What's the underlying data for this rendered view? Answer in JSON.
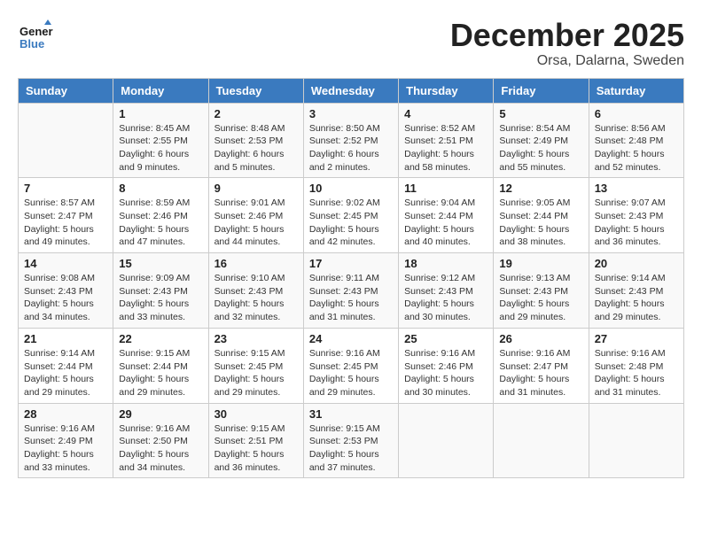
{
  "header": {
    "logo_text_general": "General",
    "logo_text_blue": "Blue",
    "month_year": "December 2025",
    "location": "Orsa, Dalarna, Sweden"
  },
  "weekdays": [
    "Sunday",
    "Monday",
    "Tuesday",
    "Wednesday",
    "Thursday",
    "Friday",
    "Saturday"
  ],
  "weeks": [
    [
      {
        "day": "",
        "info": ""
      },
      {
        "day": "1",
        "info": "Sunrise: 8:45 AM\nSunset: 2:55 PM\nDaylight: 6 hours\nand 9 minutes."
      },
      {
        "day": "2",
        "info": "Sunrise: 8:48 AM\nSunset: 2:53 PM\nDaylight: 6 hours\nand 5 minutes."
      },
      {
        "day": "3",
        "info": "Sunrise: 8:50 AM\nSunset: 2:52 PM\nDaylight: 6 hours\nand 2 minutes."
      },
      {
        "day": "4",
        "info": "Sunrise: 8:52 AM\nSunset: 2:51 PM\nDaylight: 5 hours\nand 58 minutes."
      },
      {
        "day": "5",
        "info": "Sunrise: 8:54 AM\nSunset: 2:49 PM\nDaylight: 5 hours\nand 55 minutes."
      },
      {
        "day": "6",
        "info": "Sunrise: 8:56 AM\nSunset: 2:48 PM\nDaylight: 5 hours\nand 52 minutes."
      }
    ],
    [
      {
        "day": "7",
        "info": "Sunrise: 8:57 AM\nSunset: 2:47 PM\nDaylight: 5 hours\nand 49 minutes."
      },
      {
        "day": "8",
        "info": "Sunrise: 8:59 AM\nSunset: 2:46 PM\nDaylight: 5 hours\nand 47 minutes."
      },
      {
        "day": "9",
        "info": "Sunrise: 9:01 AM\nSunset: 2:46 PM\nDaylight: 5 hours\nand 44 minutes."
      },
      {
        "day": "10",
        "info": "Sunrise: 9:02 AM\nSunset: 2:45 PM\nDaylight: 5 hours\nand 42 minutes."
      },
      {
        "day": "11",
        "info": "Sunrise: 9:04 AM\nSunset: 2:44 PM\nDaylight: 5 hours\nand 40 minutes."
      },
      {
        "day": "12",
        "info": "Sunrise: 9:05 AM\nSunset: 2:44 PM\nDaylight: 5 hours\nand 38 minutes."
      },
      {
        "day": "13",
        "info": "Sunrise: 9:07 AM\nSunset: 2:43 PM\nDaylight: 5 hours\nand 36 minutes."
      }
    ],
    [
      {
        "day": "14",
        "info": "Sunrise: 9:08 AM\nSunset: 2:43 PM\nDaylight: 5 hours\nand 34 minutes."
      },
      {
        "day": "15",
        "info": "Sunrise: 9:09 AM\nSunset: 2:43 PM\nDaylight: 5 hours\nand 33 minutes."
      },
      {
        "day": "16",
        "info": "Sunrise: 9:10 AM\nSunset: 2:43 PM\nDaylight: 5 hours\nand 32 minutes."
      },
      {
        "day": "17",
        "info": "Sunrise: 9:11 AM\nSunset: 2:43 PM\nDaylight: 5 hours\nand 31 minutes."
      },
      {
        "day": "18",
        "info": "Sunrise: 9:12 AM\nSunset: 2:43 PM\nDaylight: 5 hours\nand 30 minutes."
      },
      {
        "day": "19",
        "info": "Sunrise: 9:13 AM\nSunset: 2:43 PM\nDaylight: 5 hours\nand 29 minutes."
      },
      {
        "day": "20",
        "info": "Sunrise: 9:14 AM\nSunset: 2:43 PM\nDaylight: 5 hours\nand 29 minutes."
      }
    ],
    [
      {
        "day": "21",
        "info": "Sunrise: 9:14 AM\nSunset: 2:44 PM\nDaylight: 5 hours\nand 29 minutes."
      },
      {
        "day": "22",
        "info": "Sunrise: 9:15 AM\nSunset: 2:44 PM\nDaylight: 5 hours\nand 29 minutes."
      },
      {
        "day": "23",
        "info": "Sunrise: 9:15 AM\nSunset: 2:45 PM\nDaylight: 5 hours\nand 29 minutes."
      },
      {
        "day": "24",
        "info": "Sunrise: 9:16 AM\nSunset: 2:45 PM\nDaylight: 5 hours\nand 29 minutes."
      },
      {
        "day": "25",
        "info": "Sunrise: 9:16 AM\nSunset: 2:46 PM\nDaylight: 5 hours\nand 30 minutes."
      },
      {
        "day": "26",
        "info": "Sunrise: 9:16 AM\nSunset: 2:47 PM\nDaylight: 5 hours\nand 31 minutes."
      },
      {
        "day": "27",
        "info": "Sunrise: 9:16 AM\nSunset: 2:48 PM\nDaylight: 5 hours\nand 31 minutes."
      }
    ],
    [
      {
        "day": "28",
        "info": "Sunrise: 9:16 AM\nSunset: 2:49 PM\nDaylight: 5 hours\nand 33 minutes."
      },
      {
        "day": "29",
        "info": "Sunrise: 9:16 AM\nSunset: 2:50 PM\nDaylight: 5 hours\nand 34 minutes."
      },
      {
        "day": "30",
        "info": "Sunrise: 9:15 AM\nSunset: 2:51 PM\nDaylight: 5 hours\nand 36 minutes."
      },
      {
        "day": "31",
        "info": "Sunrise: 9:15 AM\nSunset: 2:53 PM\nDaylight: 5 hours\nand 37 minutes."
      },
      {
        "day": "",
        "info": ""
      },
      {
        "day": "",
        "info": ""
      },
      {
        "day": "",
        "info": ""
      }
    ]
  ]
}
